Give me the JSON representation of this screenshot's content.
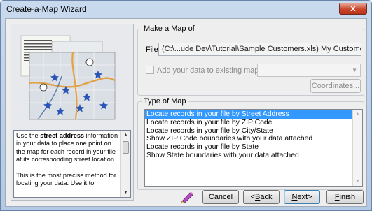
{
  "window": {
    "title": "Create-a-Map Wizard",
    "close_glyph": "x"
  },
  "description": {
    "pre": "Use the ",
    "bold": "street address",
    "post": " information in your data to place one point on the map for each record in your file at its corresponding street location.",
    "para2": "This is the most precise method for locating your data. Use it to"
  },
  "make_map": {
    "group_label": "Make a Map of",
    "file_label": "File",
    "file_value": "(C:\\...ude Dev\\Tutorial\\Sample Customers.xls) My Customers",
    "add_data_label": "Add your data to existing map",
    "add_data_checked": false,
    "existing_map_value": "",
    "coordinates_button": "Coordinates..."
  },
  "type_of_map": {
    "group_label": "Type of Map",
    "items": [
      "Locate records in your file by Street Address",
      "Locate records in your file by ZIP Code",
      "Locate records in your file by City/State",
      "Show ZIP Code boundaries with your data attached",
      "Locate records in your file by State",
      "Show State boundaries with your data attached"
    ],
    "selected_index": 0
  },
  "footer": {
    "help_icon": "help-pencil-icon",
    "cancel": "Cancel",
    "back_mnem": "B",
    "back_pre": "<",
    "back_post": "ack",
    "next_mnem": "N",
    "next_post": "ext>",
    "finish_mnem": "F",
    "finish_post": "inish"
  },
  "colors": {
    "selection": "#3399ff",
    "close": "#c9452a"
  }
}
